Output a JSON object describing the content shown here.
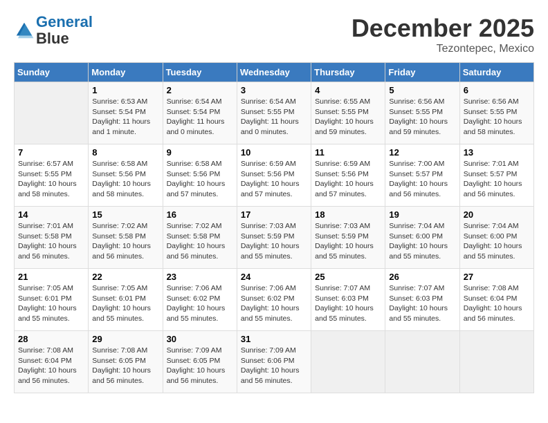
{
  "header": {
    "logo_line1": "General",
    "logo_line2": "Blue",
    "month": "December 2025",
    "location": "Tezontepec, Mexico"
  },
  "days_of_week": [
    "Sunday",
    "Monday",
    "Tuesday",
    "Wednesday",
    "Thursday",
    "Friday",
    "Saturday"
  ],
  "weeks": [
    [
      {
        "day": "",
        "info": ""
      },
      {
        "day": "1",
        "info": "Sunrise: 6:53 AM\nSunset: 5:54 PM\nDaylight: 11 hours\nand 1 minute."
      },
      {
        "day": "2",
        "info": "Sunrise: 6:54 AM\nSunset: 5:54 PM\nDaylight: 11 hours\nand 0 minutes."
      },
      {
        "day": "3",
        "info": "Sunrise: 6:54 AM\nSunset: 5:55 PM\nDaylight: 11 hours\nand 0 minutes."
      },
      {
        "day": "4",
        "info": "Sunrise: 6:55 AM\nSunset: 5:55 PM\nDaylight: 10 hours\nand 59 minutes."
      },
      {
        "day": "5",
        "info": "Sunrise: 6:56 AM\nSunset: 5:55 PM\nDaylight: 10 hours\nand 59 minutes."
      },
      {
        "day": "6",
        "info": "Sunrise: 6:56 AM\nSunset: 5:55 PM\nDaylight: 10 hours\nand 58 minutes."
      }
    ],
    [
      {
        "day": "7",
        "info": "Sunrise: 6:57 AM\nSunset: 5:55 PM\nDaylight: 10 hours\nand 58 minutes."
      },
      {
        "day": "8",
        "info": "Sunrise: 6:58 AM\nSunset: 5:56 PM\nDaylight: 10 hours\nand 58 minutes."
      },
      {
        "day": "9",
        "info": "Sunrise: 6:58 AM\nSunset: 5:56 PM\nDaylight: 10 hours\nand 57 minutes."
      },
      {
        "day": "10",
        "info": "Sunrise: 6:59 AM\nSunset: 5:56 PM\nDaylight: 10 hours\nand 57 minutes."
      },
      {
        "day": "11",
        "info": "Sunrise: 6:59 AM\nSunset: 5:56 PM\nDaylight: 10 hours\nand 57 minutes."
      },
      {
        "day": "12",
        "info": "Sunrise: 7:00 AM\nSunset: 5:57 PM\nDaylight: 10 hours\nand 56 minutes."
      },
      {
        "day": "13",
        "info": "Sunrise: 7:01 AM\nSunset: 5:57 PM\nDaylight: 10 hours\nand 56 minutes."
      }
    ],
    [
      {
        "day": "14",
        "info": "Sunrise: 7:01 AM\nSunset: 5:58 PM\nDaylight: 10 hours\nand 56 minutes."
      },
      {
        "day": "15",
        "info": "Sunrise: 7:02 AM\nSunset: 5:58 PM\nDaylight: 10 hours\nand 56 minutes."
      },
      {
        "day": "16",
        "info": "Sunrise: 7:02 AM\nSunset: 5:58 PM\nDaylight: 10 hours\nand 56 minutes."
      },
      {
        "day": "17",
        "info": "Sunrise: 7:03 AM\nSunset: 5:59 PM\nDaylight: 10 hours\nand 55 minutes."
      },
      {
        "day": "18",
        "info": "Sunrise: 7:03 AM\nSunset: 5:59 PM\nDaylight: 10 hours\nand 55 minutes."
      },
      {
        "day": "19",
        "info": "Sunrise: 7:04 AM\nSunset: 6:00 PM\nDaylight: 10 hours\nand 55 minutes."
      },
      {
        "day": "20",
        "info": "Sunrise: 7:04 AM\nSunset: 6:00 PM\nDaylight: 10 hours\nand 55 minutes."
      }
    ],
    [
      {
        "day": "21",
        "info": "Sunrise: 7:05 AM\nSunset: 6:01 PM\nDaylight: 10 hours\nand 55 minutes."
      },
      {
        "day": "22",
        "info": "Sunrise: 7:05 AM\nSunset: 6:01 PM\nDaylight: 10 hours\nand 55 minutes."
      },
      {
        "day": "23",
        "info": "Sunrise: 7:06 AM\nSunset: 6:02 PM\nDaylight: 10 hours\nand 55 minutes."
      },
      {
        "day": "24",
        "info": "Sunrise: 7:06 AM\nSunset: 6:02 PM\nDaylight: 10 hours\nand 55 minutes."
      },
      {
        "day": "25",
        "info": "Sunrise: 7:07 AM\nSunset: 6:03 PM\nDaylight: 10 hours\nand 55 minutes."
      },
      {
        "day": "26",
        "info": "Sunrise: 7:07 AM\nSunset: 6:03 PM\nDaylight: 10 hours\nand 55 minutes."
      },
      {
        "day": "27",
        "info": "Sunrise: 7:08 AM\nSunset: 6:04 PM\nDaylight: 10 hours\nand 56 minutes."
      }
    ],
    [
      {
        "day": "28",
        "info": "Sunrise: 7:08 AM\nSunset: 6:04 PM\nDaylight: 10 hours\nand 56 minutes."
      },
      {
        "day": "29",
        "info": "Sunrise: 7:08 AM\nSunset: 6:05 PM\nDaylight: 10 hours\nand 56 minutes."
      },
      {
        "day": "30",
        "info": "Sunrise: 7:09 AM\nSunset: 6:05 PM\nDaylight: 10 hours\nand 56 minutes."
      },
      {
        "day": "31",
        "info": "Sunrise: 7:09 AM\nSunset: 6:06 PM\nDaylight: 10 hours\nand 56 minutes."
      },
      {
        "day": "",
        "info": ""
      },
      {
        "day": "",
        "info": ""
      },
      {
        "day": "",
        "info": ""
      }
    ]
  ]
}
